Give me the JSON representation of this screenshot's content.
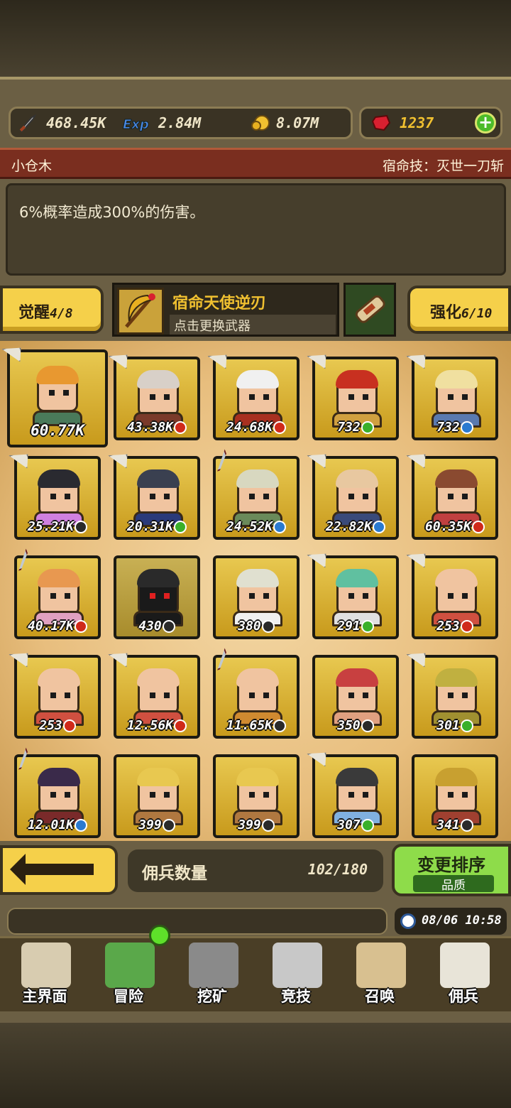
{
  "resources": {
    "attack": "468.45K",
    "exp": "2.84M",
    "gold": "8.07M",
    "gems": "1237"
  },
  "title": {
    "name": "小仓木",
    "skill": "宿命技：灭世一刀斩"
  },
  "description": "6%概率造成300%的伤害。",
  "awaken": {
    "label": "觉醒",
    "value": "4/8"
  },
  "enhance": {
    "label": "强化",
    "value": "6/10"
  },
  "weapon": {
    "name": "宿命天使逆刃",
    "hint": "点击更换武器"
  },
  "mercenaries": [
    {
      "value": "60.77K",
      "badge": "",
      "hair": "#e89830",
      "body": "#4a7a5a",
      "flag": "paper"
    },
    {
      "value": "43.38K",
      "badge": "red",
      "hair": "#d8d0c8",
      "body": "#7a3a2a",
      "flag": "paper"
    },
    {
      "value": "24.68K",
      "badge": "red",
      "hair": "#f0f0f0",
      "body": "#a83020",
      "flag": "paper"
    },
    {
      "value": "732",
      "badge": "green",
      "hair": "#c83020",
      "body": "#d0a040",
      "flag": "paper"
    },
    {
      "value": "732",
      "badge": "blue",
      "hair": "#f0e0a0",
      "body": "#5a7ab0",
      "flag": "paper"
    },
    {
      "value": "25.21K",
      "badge": "grey",
      "hair": "#2a2a30",
      "body": "#d080e0",
      "flag": "paper"
    },
    {
      "value": "20.31K",
      "badge": "green",
      "hair": "#3a4050",
      "body": "#2a3a7a",
      "flag": "paper"
    },
    {
      "value": "24.52K",
      "badge": "blue",
      "hair": "#d8d8c0",
      "body": "#6a8a5a",
      "flag": "sword"
    },
    {
      "value": "22.82K",
      "badge": "blue",
      "hair": "#e8c8a0",
      "body": "#3a4a7a",
      "flag": "paper"
    },
    {
      "value": "60.35K",
      "badge": "red",
      "hair": "#8a4a30",
      "body": "#c04040",
      "flag": "paper"
    },
    {
      "value": "40.17K",
      "badge": "red",
      "hair": "#e89850",
      "body": "#e0a0c0",
      "flag": "sword"
    },
    {
      "value": "430",
      "badge": "grey",
      "hair": "#2a2a2a",
      "body": "#1a1a1a",
      "flag": ""
    },
    {
      "value": "380",
      "badge": "grey",
      "hair": "#e0e0d0",
      "body": "#f0f0f0",
      "flag": ""
    },
    {
      "value": "291",
      "badge": "green",
      "hair": "#60c0a0",
      "body": "#e0e0e0",
      "flag": "paper"
    },
    {
      "value": "253",
      "badge": "red",
      "hair": "#f0c4a0",
      "body": "#d05040",
      "flag": "paper"
    },
    {
      "value": "253",
      "badge": "red",
      "hair": "#f0c4a0",
      "body": "#d05040",
      "flag": "paper"
    },
    {
      "value": "12.56K",
      "badge": "red",
      "hair": "#f0c4a0",
      "body": "#d05040",
      "flag": "paper"
    },
    {
      "value": "11.65K",
      "badge": "grey",
      "hair": "#f0c4a0",
      "body": "#d08a30",
      "flag": "sword"
    },
    {
      "value": "350",
      "badge": "grey",
      "hair": "#c84040",
      "body": "#e0a080",
      "flag": ""
    },
    {
      "value": "301",
      "badge": "green",
      "hair": "#c0b040",
      "body": "#a09030",
      "flag": "paper"
    },
    {
      "value": "12.01K",
      "badge": "blue",
      "hair": "#3a2a4a",
      "body": "#7a2a2a",
      "flag": "sword"
    },
    {
      "value": "399",
      "badge": "grey",
      "hair": "#e8c850",
      "body": "#b07840",
      "flag": ""
    },
    {
      "value": "399",
      "badge": "grey",
      "hair": "#e8c850",
      "body": "#b07840",
      "flag": ""
    },
    {
      "value": "307",
      "badge": "green",
      "hair": "#3a3a3a",
      "body": "#80b0e0",
      "flag": "paper"
    },
    {
      "value": "341",
      "badge": "grey",
      "hair": "#c8a030",
      "body": "#a04030",
      "flag": ""
    }
  ],
  "footer": {
    "count_label": "佣兵数量",
    "count_value": "102/180",
    "sort_label": "变更排序",
    "sort_value": "品质",
    "time": "08/06 10:58"
  },
  "nav": [
    {
      "label": "主界面",
      "icon": "map-icon",
      "color": "#d8ccb0"
    },
    {
      "label": "冒险",
      "icon": "island-icon",
      "color": "#5aa84a"
    },
    {
      "label": "挖矿",
      "icon": "pickaxe-icon",
      "color": "#8a8a8a"
    },
    {
      "label": "竞技",
      "icon": "crossed-swords-icon",
      "color": "#c8c8c8"
    },
    {
      "label": "召唤",
      "icon": "scroll-icon",
      "color": "#d8c090"
    },
    {
      "label": "佣兵",
      "icon": "tent-icon",
      "color": "#e8e4d8"
    }
  ],
  "colors": {
    "badge_red": "#d02a1a",
    "badge_green": "#3ab02a",
    "badge_blue": "#2a7ad0",
    "badge_grey": "#2a2a2a"
  }
}
